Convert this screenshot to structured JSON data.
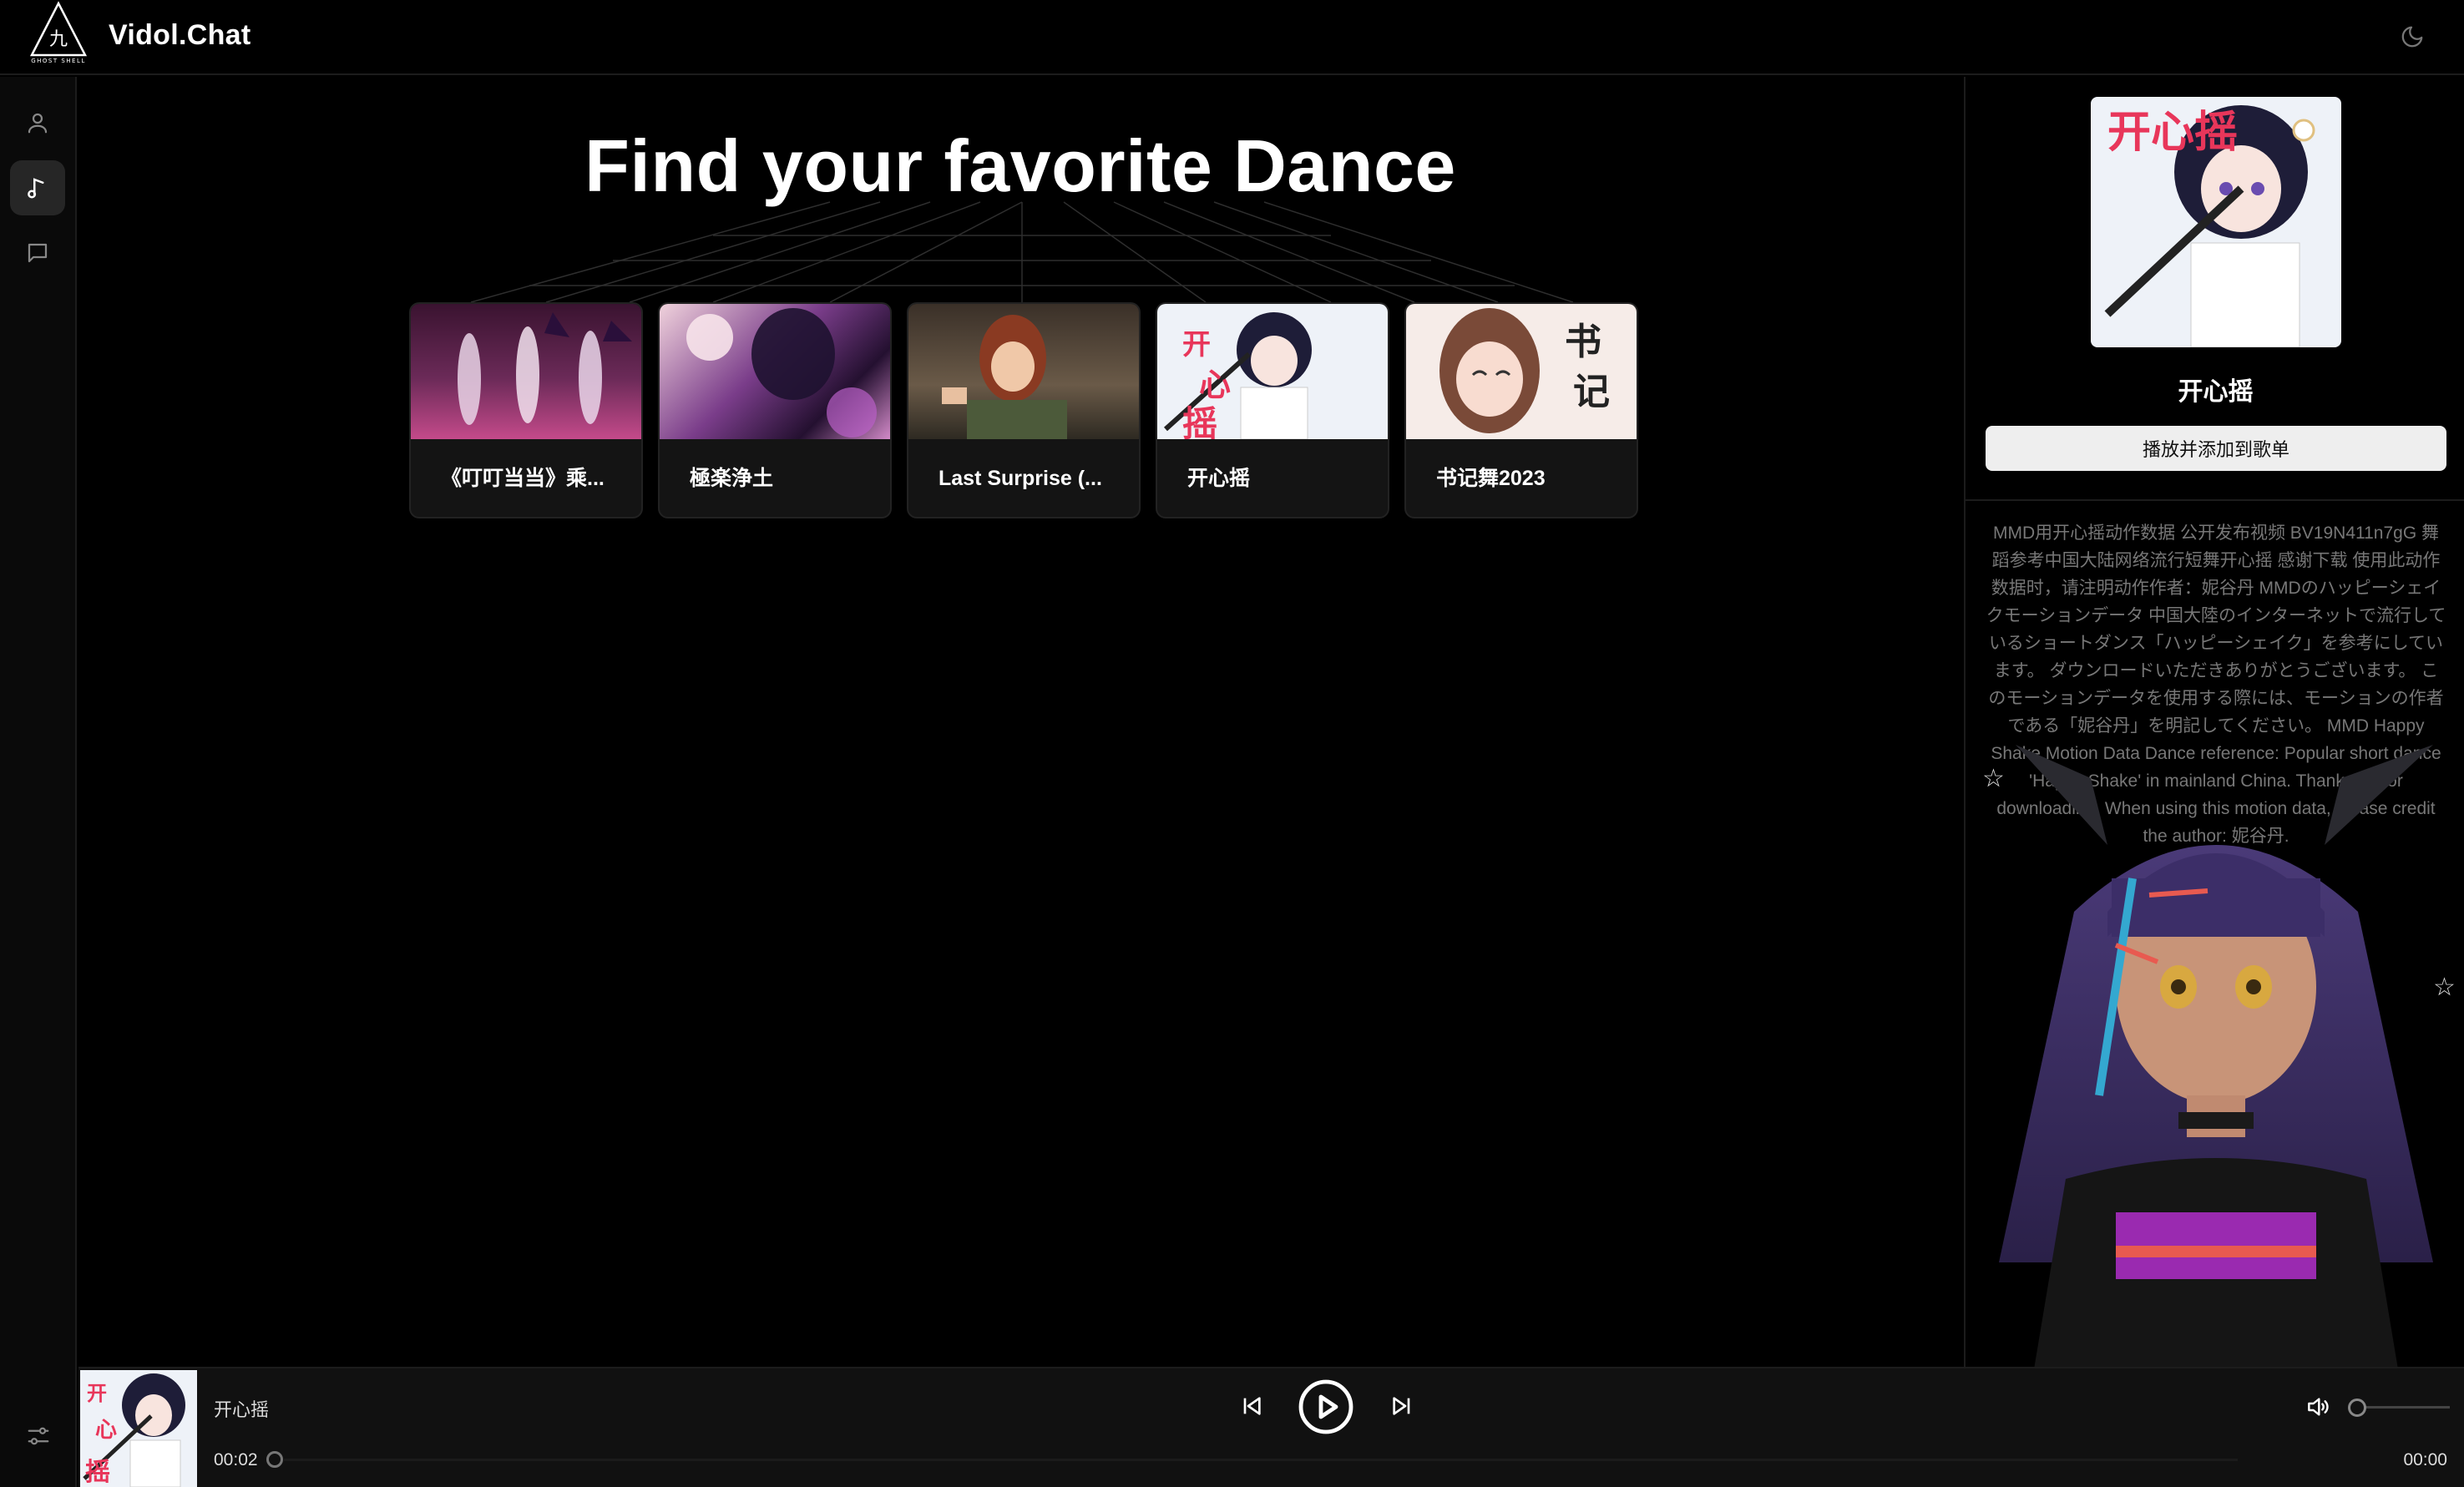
{
  "header": {
    "brand": "Vidol.Chat",
    "logo_glyph": "九",
    "logo_caption": "GHOST SHELL",
    "theme_icon": "moon-icon"
  },
  "sidebar": {
    "items": [
      {
        "icon": "user-icon",
        "active": false
      },
      {
        "icon": "music-note-icon",
        "active": true
      },
      {
        "icon": "chat-icon",
        "active": false
      }
    ],
    "bottom_icon": "sliders-icon"
  },
  "main": {
    "title": "Find your favorite Dance",
    "cards": [
      {
        "name": "《叮叮当当》乘..."
      },
      {
        "name": "極楽浄土"
      },
      {
        "name": "Last Surprise (..."
      },
      {
        "name": "开心摇"
      },
      {
        "name": "书记舞2023"
      }
    ]
  },
  "detail": {
    "cover_text": "开心摇",
    "title": "开心摇",
    "play_add_label": "播放并添加到歌单",
    "description": "MMD用开心摇动作数据 公开发布视频 BV19N411n7gG 舞蹈参考中国大陆网络流行短舞开心摇 感谢下载 使用此动作数据时，请注明动作作者：妮谷丹 MMDのハッピーシェイクモーションデータ 中国大陸のインターネットで流行しているショートダンス「ハッピーシェイク」を参考にしています。 ダウンロードいただきありがとうございます。 このモーションデータを使用する際には、モーションの作者である「妮谷丹」を明記してください。 MMD Happy Shake Motion Data Dance reference: Popular short dance 'Happy Shake' in mainland China. Thank you for downloading. When using this motion data, please credit the author: 妮谷丹."
  },
  "player": {
    "track_title": "开心摇",
    "current_time": "00:02",
    "duration": "00:00",
    "progress": 0.0
  },
  "colors": {
    "background": "#000000",
    "panel": "#141414",
    "accent_pink": "#e8365a"
  }
}
